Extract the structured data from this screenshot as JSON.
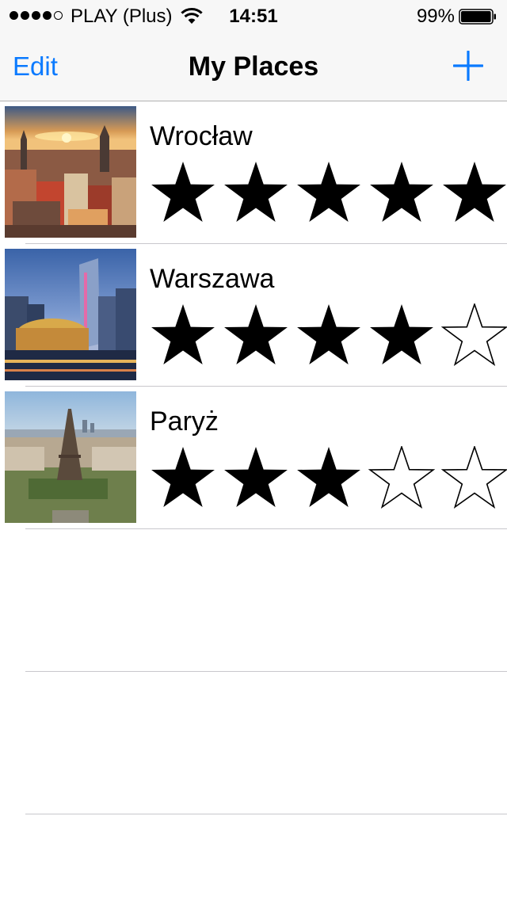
{
  "status_bar": {
    "signal_dots_filled": 4,
    "signal_dots_total": 5,
    "carrier": "PLAY (Plus)",
    "time": "14:51",
    "battery_percent": "99%",
    "battery_level": 0.99
  },
  "nav": {
    "edit_label": "Edit",
    "title": "My Places",
    "add_icon": "plus-icon"
  },
  "places": [
    {
      "name": "Wrocław",
      "rating": 5
    },
    {
      "name": "Warszawa",
      "rating": 4
    },
    {
      "name": "Paryż",
      "rating": 3
    }
  ],
  "max_rating": 5,
  "colors": {
    "tint": "#0a7aff",
    "bar_background": "#f7f7f7",
    "separator": "#c8c7cc"
  }
}
